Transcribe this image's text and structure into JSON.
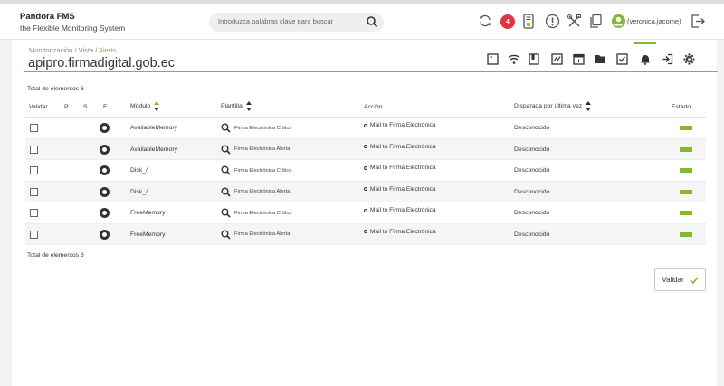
{
  "brand": {
    "name": "Pandora FMS",
    "subtitle": "the Flexible Monitoring System"
  },
  "search": {
    "placeholder": "Introduzca palabras clave para buscar"
  },
  "header": {
    "notification_count": "4",
    "user_name": "(veronica.jacome)"
  },
  "breadcrumb": {
    "part1": "Monitorización",
    "sep1": " / ",
    "part2": "Vista",
    "sep2": " / ",
    "current": "Alerts"
  },
  "page_title": "apipro.firmadigital.gob.ec",
  "totals": {
    "top": "Total de elementos 6",
    "bottom": "Total de elementos 6"
  },
  "table": {
    "headers": {
      "validar": "Validar",
      "p": "P.",
      "s": "S.",
      "f": "F.",
      "modulo": "Módulo",
      "plantilla": "Plantilla",
      "accion": "Acción",
      "disparada": "Disparada por última vez",
      "estado": "Estado"
    },
    "rows": [
      {
        "module": "AvailableMemory",
        "template": "Firma Electrónica Crítico",
        "action": "Mail to Firma Electrónica",
        "last_fired": "Desconocido"
      },
      {
        "module": "AvailableMemory",
        "template": "Firma Electrónica Alerta",
        "action": "Mail to Firma Electrónica",
        "last_fired": "Desconocido"
      },
      {
        "module": "Disk_/",
        "template": "Firma Electrónica Crítico",
        "action": "Mail to Firma Electrónica",
        "last_fired": "Desconocido"
      },
      {
        "module": "Disk_/",
        "template": "Firma Electrónica Alerta",
        "action": "Mail to Firma Electrónica",
        "last_fired": "Desconocido"
      },
      {
        "module": "FreeMemory",
        "template": "Firma Electrónica Crítico",
        "action": "Mail to Firma Electrónica",
        "last_fired": "Desconocido"
      },
      {
        "module": "FreeMemory",
        "template": "Firma Electrónica Alerta",
        "action": "Mail to Firma Electrónica",
        "last_fired": "Desconocido"
      }
    ]
  },
  "validate_button": {
    "label": "Validar"
  },
  "colors": {
    "accent": "#82b92e",
    "badge": "#e3333d",
    "status_ok": "#82b92e"
  }
}
